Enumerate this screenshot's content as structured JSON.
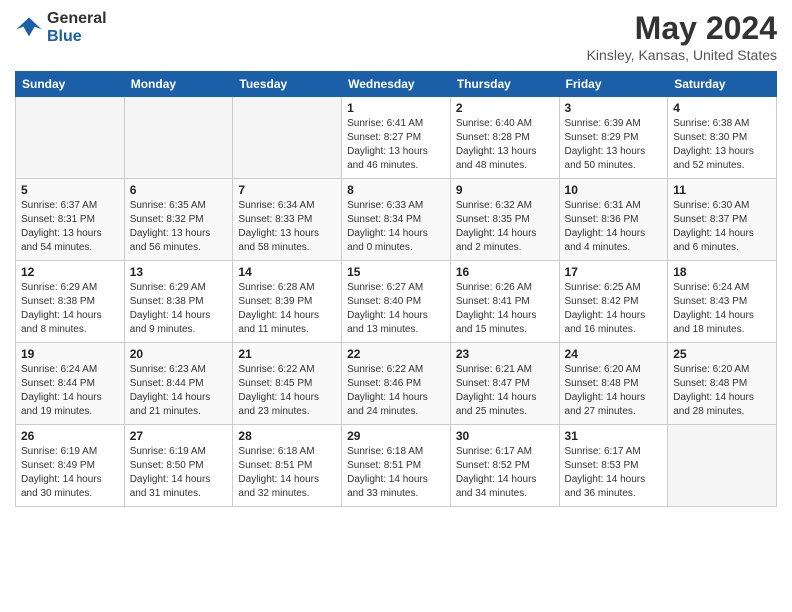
{
  "header": {
    "logo_line1": "General",
    "logo_line2": "Blue",
    "month_title": "May 2024",
    "location": "Kinsley, Kansas, United States"
  },
  "weekdays": [
    "Sunday",
    "Monday",
    "Tuesday",
    "Wednesday",
    "Thursday",
    "Friday",
    "Saturday"
  ],
  "weeks": [
    [
      {
        "day": "",
        "info": ""
      },
      {
        "day": "",
        "info": ""
      },
      {
        "day": "",
        "info": ""
      },
      {
        "day": "1",
        "info": "Sunrise: 6:41 AM\nSunset: 8:27 PM\nDaylight: 13 hours\nand 46 minutes."
      },
      {
        "day": "2",
        "info": "Sunrise: 6:40 AM\nSunset: 8:28 PM\nDaylight: 13 hours\nand 48 minutes."
      },
      {
        "day": "3",
        "info": "Sunrise: 6:39 AM\nSunset: 8:29 PM\nDaylight: 13 hours\nand 50 minutes."
      },
      {
        "day": "4",
        "info": "Sunrise: 6:38 AM\nSunset: 8:30 PM\nDaylight: 13 hours\nand 52 minutes."
      }
    ],
    [
      {
        "day": "5",
        "info": "Sunrise: 6:37 AM\nSunset: 8:31 PM\nDaylight: 13 hours\nand 54 minutes."
      },
      {
        "day": "6",
        "info": "Sunrise: 6:35 AM\nSunset: 8:32 PM\nDaylight: 13 hours\nand 56 minutes."
      },
      {
        "day": "7",
        "info": "Sunrise: 6:34 AM\nSunset: 8:33 PM\nDaylight: 13 hours\nand 58 minutes."
      },
      {
        "day": "8",
        "info": "Sunrise: 6:33 AM\nSunset: 8:34 PM\nDaylight: 14 hours\nand 0 minutes."
      },
      {
        "day": "9",
        "info": "Sunrise: 6:32 AM\nSunset: 8:35 PM\nDaylight: 14 hours\nand 2 minutes."
      },
      {
        "day": "10",
        "info": "Sunrise: 6:31 AM\nSunset: 8:36 PM\nDaylight: 14 hours\nand 4 minutes."
      },
      {
        "day": "11",
        "info": "Sunrise: 6:30 AM\nSunset: 8:37 PM\nDaylight: 14 hours\nand 6 minutes."
      }
    ],
    [
      {
        "day": "12",
        "info": "Sunrise: 6:29 AM\nSunset: 8:38 PM\nDaylight: 14 hours\nand 8 minutes."
      },
      {
        "day": "13",
        "info": "Sunrise: 6:29 AM\nSunset: 8:38 PM\nDaylight: 14 hours\nand 9 minutes."
      },
      {
        "day": "14",
        "info": "Sunrise: 6:28 AM\nSunset: 8:39 PM\nDaylight: 14 hours\nand 11 minutes."
      },
      {
        "day": "15",
        "info": "Sunrise: 6:27 AM\nSunset: 8:40 PM\nDaylight: 14 hours\nand 13 minutes."
      },
      {
        "day": "16",
        "info": "Sunrise: 6:26 AM\nSunset: 8:41 PM\nDaylight: 14 hours\nand 15 minutes."
      },
      {
        "day": "17",
        "info": "Sunrise: 6:25 AM\nSunset: 8:42 PM\nDaylight: 14 hours\nand 16 minutes."
      },
      {
        "day": "18",
        "info": "Sunrise: 6:24 AM\nSunset: 8:43 PM\nDaylight: 14 hours\nand 18 minutes."
      }
    ],
    [
      {
        "day": "19",
        "info": "Sunrise: 6:24 AM\nSunset: 8:44 PM\nDaylight: 14 hours\nand 19 minutes."
      },
      {
        "day": "20",
        "info": "Sunrise: 6:23 AM\nSunset: 8:44 PM\nDaylight: 14 hours\nand 21 minutes."
      },
      {
        "day": "21",
        "info": "Sunrise: 6:22 AM\nSunset: 8:45 PM\nDaylight: 14 hours\nand 23 minutes."
      },
      {
        "day": "22",
        "info": "Sunrise: 6:22 AM\nSunset: 8:46 PM\nDaylight: 14 hours\nand 24 minutes."
      },
      {
        "day": "23",
        "info": "Sunrise: 6:21 AM\nSunset: 8:47 PM\nDaylight: 14 hours\nand 25 minutes."
      },
      {
        "day": "24",
        "info": "Sunrise: 6:20 AM\nSunset: 8:48 PM\nDaylight: 14 hours\nand 27 minutes."
      },
      {
        "day": "25",
        "info": "Sunrise: 6:20 AM\nSunset: 8:48 PM\nDaylight: 14 hours\nand 28 minutes."
      }
    ],
    [
      {
        "day": "26",
        "info": "Sunrise: 6:19 AM\nSunset: 8:49 PM\nDaylight: 14 hours\nand 30 minutes."
      },
      {
        "day": "27",
        "info": "Sunrise: 6:19 AM\nSunset: 8:50 PM\nDaylight: 14 hours\nand 31 minutes."
      },
      {
        "day": "28",
        "info": "Sunrise: 6:18 AM\nSunset: 8:51 PM\nDaylight: 14 hours\nand 32 minutes."
      },
      {
        "day": "29",
        "info": "Sunrise: 6:18 AM\nSunset: 8:51 PM\nDaylight: 14 hours\nand 33 minutes."
      },
      {
        "day": "30",
        "info": "Sunrise: 6:17 AM\nSunset: 8:52 PM\nDaylight: 14 hours\nand 34 minutes."
      },
      {
        "day": "31",
        "info": "Sunrise: 6:17 AM\nSunset: 8:53 PM\nDaylight: 14 hours\nand 36 minutes."
      },
      {
        "day": "",
        "info": ""
      }
    ]
  ]
}
